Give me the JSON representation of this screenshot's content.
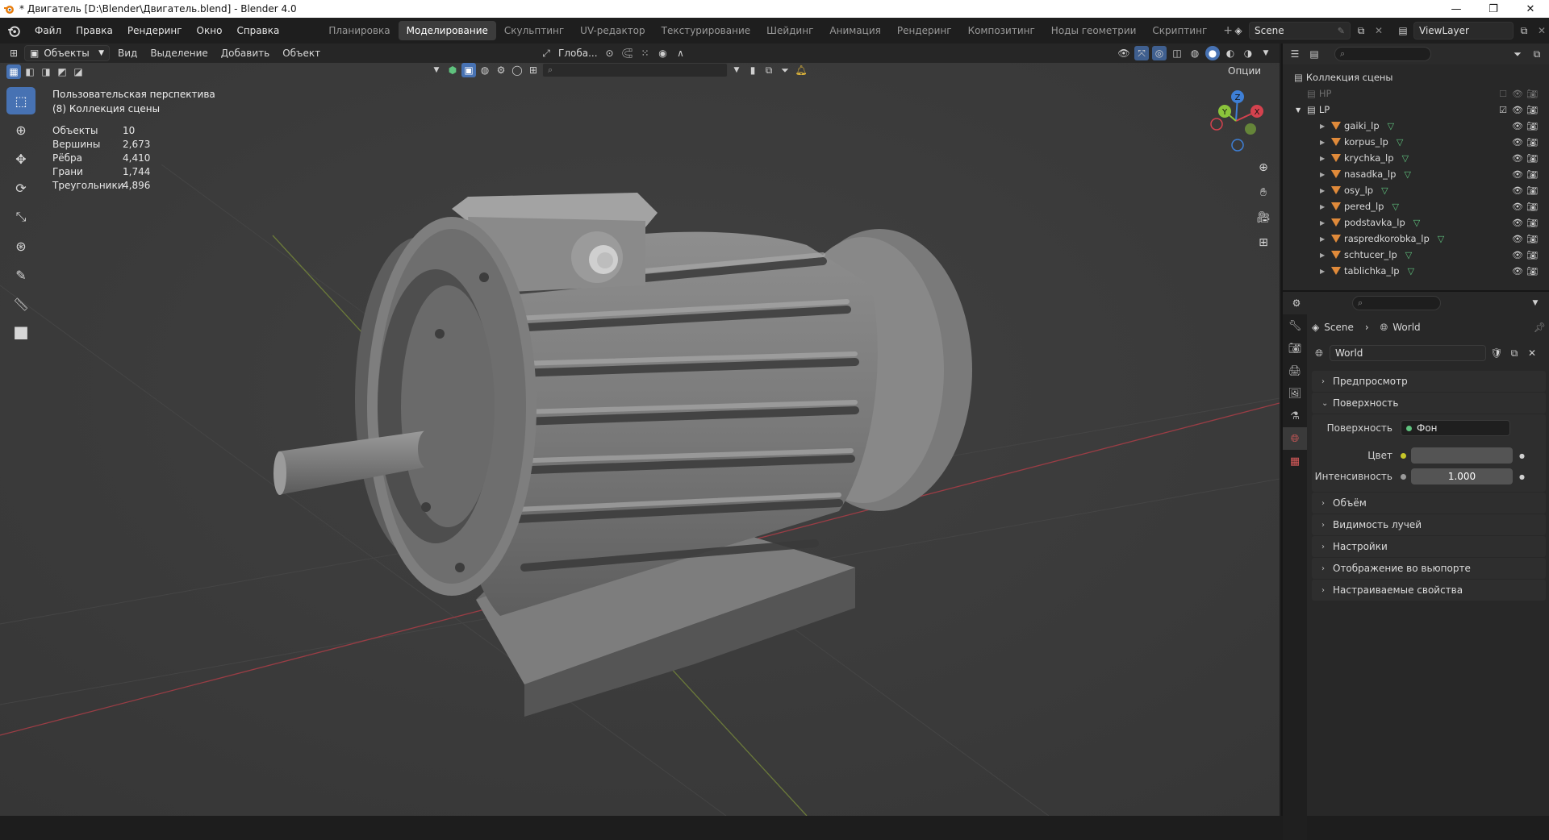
{
  "window": {
    "title": "* Двигатель [D:\\Blender\\Двигатель.blend] - Blender 4.0",
    "minimize": "—",
    "restore": "❐",
    "close": "✕"
  },
  "menus": [
    "Файл",
    "Правка",
    "Рендеринг",
    "Окно",
    "Справка"
  ],
  "workspaces": [
    "Планировка",
    "Моделирование",
    "Скульптинг",
    "UV-редактор",
    "Текстурирование",
    "Шейдинг",
    "Анимация",
    "Рендеринг",
    "Композитинг",
    "Ноды геометрии",
    "Скриптинг"
  ],
  "active_workspace": "Моделирование",
  "add_workspace": "+",
  "scene": {
    "label": "Scene",
    "view_layer": "ViewLayer"
  },
  "viewport_header": {
    "mode": "Объекты",
    "menu": [
      "Вид",
      "Выделение",
      "Добавить",
      "Объект"
    ],
    "transform_orientation": "Глоба...",
    "options": "Опции"
  },
  "viewport_overlay": {
    "view_name": "Пользовательская перспектива",
    "collection": "(8) Коллекция сцены",
    "stats": [
      {
        "label": "Объекты",
        "value": "10"
      },
      {
        "label": "Вершины",
        "value": "2,673"
      },
      {
        "label": "Рёбра",
        "value": "4,410"
      },
      {
        "label": "Грани",
        "value": "1,744"
      },
      {
        "label": "Треугольники",
        "value": "4,896"
      }
    ]
  },
  "gizmo": {
    "x": "X",
    "y": "Y",
    "z": "Z"
  },
  "outliner": {
    "root": "Коллекция сцены",
    "collections": [
      {
        "name": "HP",
        "disabled": true
      },
      {
        "name": "LP",
        "disabled": false
      }
    ],
    "objects": [
      "gaiki_lp",
      "korpus_lp",
      "krychka_lp",
      "nasadka_lp",
      "osy_lp",
      "pered_lp",
      "podstavka_lp",
      "raspredkorobka_lp",
      "schtucer_lp",
      "tablichka_lp"
    ]
  },
  "properties": {
    "breadcrumb_scene": "Scene",
    "breadcrumb_world": "World",
    "world_name": "World",
    "panels_top": [
      "Предпросмотр"
    ],
    "surface_panel": "Поверхность",
    "surface_label": "Поверхность",
    "surface_value": "Фон",
    "color_label": "Цвет",
    "strength_label": "Интенсивность",
    "strength_value": "1.000",
    "panels_bottom": [
      "Объём",
      "Видимость лучей",
      "Настройки",
      "Отображение во вьюпорте",
      "Настраиваемые свойства"
    ]
  },
  "colors": {
    "accent": "#4772b3",
    "viewport_bg": "#3b3b3b",
    "x_axis": "#d4424e",
    "y_axis": "#8bc43b",
    "z_axis": "#3e7fd6",
    "world_color": "#545454"
  }
}
